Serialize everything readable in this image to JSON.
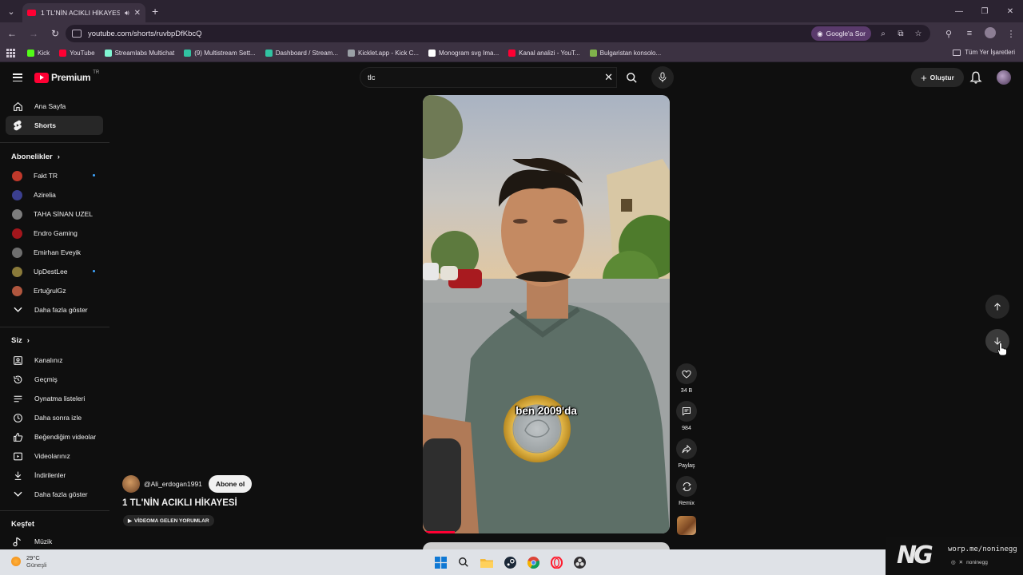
{
  "browser": {
    "tab_title": "1 TL'NİN ACIKLI HİKAYESİ -",
    "url": "youtube.com/shorts/ruvbpDfKbcQ",
    "google_sor": "Google'a Sor",
    "bookmarks": [
      {
        "label": "Kick",
        "color": "#53fc18"
      },
      {
        "label": "YouTube",
        "color": "#ff0033"
      },
      {
        "label": "Streamlabs Multichat",
        "color": "#80f5d2"
      },
      {
        "label": "(9) Multistream Sett...",
        "color": "#31c3a2"
      },
      {
        "label": "Dashboard / Stream...",
        "color": "#31c3a2"
      },
      {
        "label": "Kicklet.app - Kick C...",
        "color": "#9aa0a6"
      },
      {
        "label": "Monogram svg Ima...",
        "color": "#ffffff"
      },
      {
        "label": "Kanal analizi - YouT...",
        "color": "#ff0033"
      },
      {
        "label": "Bulgaristan konsolo...",
        "color": "#7fb24b"
      }
    ],
    "all_bookmarks": "Tüm Yer İşaretleri"
  },
  "youtube": {
    "logo_word": "Premium",
    "logo_region": "TR",
    "search_query": "tlc",
    "create_label": "Oluştur"
  },
  "sidebar": {
    "main": [
      {
        "label": "Ana Sayfa",
        "icon": "home-icon"
      },
      {
        "label": "Shorts",
        "icon": "shorts-icon"
      }
    ],
    "subscriptions_header": "Abonelikler",
    "subscriptions": [
      {
        "label": "Fakt TR",
        "color": "#c0392b",
        "dot": true
      },
      {
        "label": "Azirelia",
        "color": "#3b3f8f",
        "dot": false
      },
      {
        "label": "TAHA SİNAN UZEL",
        "color": "#7d7d7d",
        "dot": false
      },
      {
        "label": "Endro Gaming",
        "color": "#a3161c",
        "dot": false
      },
      {
        "label": "Emirhan Eveyik",
        "color": "#6f6f6f",
        "dot": false
      },
      {
        "label": "UpDestLee",
        "color": "#8a7a3a",
        "dot": true
      },
      {
        "label": "ErtuğrulGz",
        "color": "#b0563e",
        "dot": false
      }
    ],
    "subs_more": "Daha fazla göster",
    "you_header": "Siz",
    "you_items": [
      {
        "label": "Kanalınız",
        "icon": "channel-icon"
      },
      {
        "label": "Geçmiş",
        "icon": "history-icon"
      },
      {
        "label": "Oynatma listeleri",
        "icon": "playlist-icon"
      },
      {
        "label": "Daha sonra izle",
        "icon": "watch-later-icon"
      },
      {
        "label": "Beğendiğim videolar",
        "icon": "like-icon"
      },
      {
        "label": "Videolarınız",
        "icon": "videos-icon"
      },
      {
        "label": "İndirilenler",
        "icon": "download-icon"
      }
    ],
    "you_more": "Daha fazla göster",
    "explore_header": "Keşfet",
    "explore_items": [
      {
        "label": "Müzik",
        "icon": "music-icon"
      }
    ]
  },
  "short": {
    "caption": "ben 2009'da",
    "channel": "@Ali_erdogan1991",
    "subscribe": "Abone ol",
    "title": "1 TL'NİN ACIKLI HİKAYESİ",
    "comments_chip": "VİDEOMA GELEN YORUMLAR",
    "progress_fraction": 0.13,
    "likes": "34 B",
    "comments": "984",
    "share": "Paylaş",
    "remix": "Remix"
  },
  "taskbar": {
    "temp": "29°C",
    "condition": "Güneşli",
    "icons": [
      "windows-start-icon",
      "search-icon",
      "file-explorer-icon",
      "steam-icon",
      "chrome-icon",
      "opera-icon",
      "obs-icon"
    ]
  },
  "watermark": {
    "logo": "NG",
    "url": "worp.me/noninegg",
    "handle": "noninegg"
  }
}
